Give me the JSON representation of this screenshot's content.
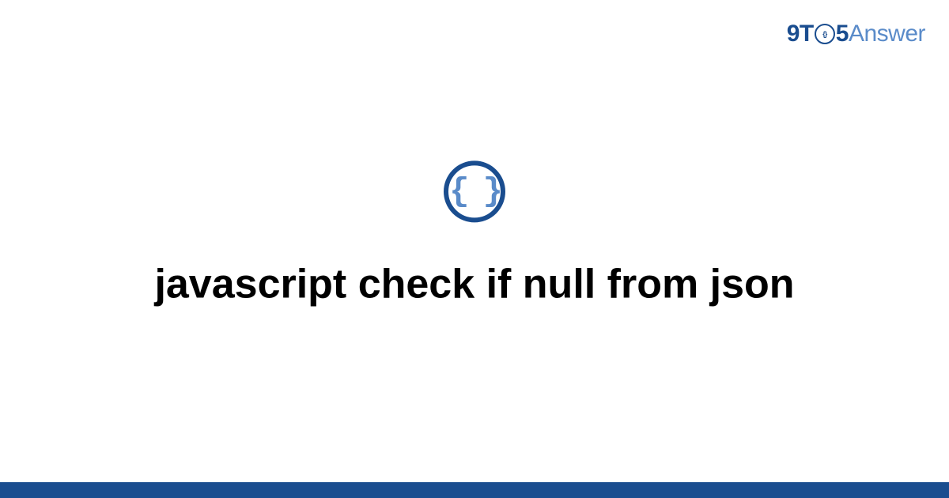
{
  "logo": {
    "part1": "9T",
    "clock_inner": "{}",
    "part2": "5",
    "part3": "Answer"
  },
  "category_icon": {
    "name": "json-braces-icon",
    "glyph": "{ }"
  },
  "title": "javascript check if null from json",
  "colors": {
    "brand_dark": "#1a4d8f",
    "brand_light": "#5a8bc9"
  }
}
